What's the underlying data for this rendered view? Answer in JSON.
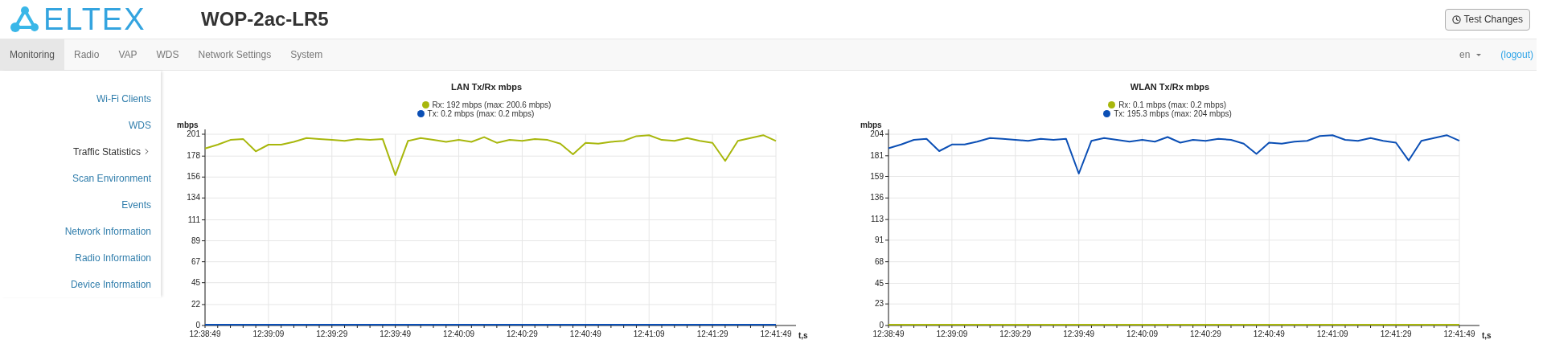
{
  "header": {
    "logo": "ELTEX",
    "title": "WOP-2ac-LR5",
    "button": "Test Changes"
  },
  "nav": {
    "tabs": [
      {
        "label": "Monitoring",
        "selected": true
      },
      {
        "label": "Radio",
        "selected": false
      },
      {
        "label": "VAP",
        "selected": false
      },
      {
        "label": "WDS",
        "selected": false
      },
      {
        "label": "Network Settings",
        "selected": false
      },
      {
        "label": "System",
        "selected": false
      }
    ],
    "language": "en",
    "logout": "(logout)"
  },
  "sidebar": {
    "items": [
      {
        "label": "Wi-Fi Clients",
        "selected": false
      },
      {
        "label": "WDS",
        "selected": false
      },
      {
        "label": "Traffic Statistics",
        "selected": true
      },
      {
        "label": "Scan Environment",
        "selected": false
      },
      {
        "label": "Events",
        "selected": false
      },
      {
        "label": "Network Information",
        "selected": false
      },
      {
        "label": "Radio Information",
        "selected": false
      },
      {
        "label": "Device Information",
        "selected": false
      }
    ]
  },
  "charts": [
    {
      "legend": [
        ": 192 mbps (max: 200.6 mbps)",
        ": 0.2 mbps (max: 0.2 mbps)"
      ],
      "chart_data": {
        "type": "line",
        "grid": true,
        "title": "LAN Tx/Rx mbps",
        "xlabel": "t,s",
        "ylabel": "mbps",
        "categories": [
          "12:38:49",
          null,
          null,
          null,
          null,
          "12:39:09",
          null,
          null,
          null,
          null,
          "12:39:29",
          null,
          null,
          null,
          null,
          "12:39:49",
          null,
          null,
          null,
          null,
          "12:40:09",
          null,
          null,
          null,
          null,
          "12:40:29",
          null,
          null,
          null,
          null,
          "12:40:49",
          null,
          null,
          null,
          null,
          "12:41:09",
          null,
          null,
          null,
          null,
          "12:41:29",
          null,
          null,
          null,
          null,
          "12:41:49"
        ],
        "ylim": [
          0,
          201
        ],
        "yticks": [
          0,
          22,
          45,
          67,
          89,
          111,
          134,
          156,
          178,
          201
        ],
        "series": [
          {
            "name": "Rx",
            "color": "#a8b70c",
            "values": [
              186,
              190,
              195,
              196,
              183,
              190,
              190,
              193,
              197,
              196,
              195,
              194,
              196,
              195,
              196,
              158,
              194,
              197,
              195,
              193,
              195,
              193,
              198,
              192,
              195,
              194,
              196,
              195,
              191,
              180,
              192,
              191,
              193,
              194,
              199,
              200,
              195,
              194,
              197,
              194,
              192,
              173,
              194,
              197,
              200,
              194
            ]
          },
          {
            "name": "Tx",
            "color": "#0b4fb5",
            "values": [
              0,
              0,
              0,
              0,
              0,
              0,
              0,
              0,
              0,
              0,
              0,
              0,
              0,
              0,
              0,
              0,
              0,
              0,
              0,
              0,
              0,
              0,
              0,
              0,
              0,
              0,
              0,
              0,
              0,
              0,
              0,
              0,
              0,
              0,
              0,
              0,
              0,
              0,
              0,
              0,
              0,
              0,
              0,
              0,
              0,
              0
            ]
          }
        ]
      }
    },
    {
      "legend": [
        ": 0.1 mbps (max: 0.2 mbps)",
        ": 195.3 mbps (max: 204 mbps)"
      ],
      "chart_data": {
        "type": "line",
        "grid": true,
        "title": "WLAN Tx/Rx mbps",
        "xlabel": "t,s",
        "ylabel": "mbps",
        "categories": [
          "12:38:49",
          null,
          null,
          null,
          null,
          "12:39:09",
          null,
          null,
          null,
          null,
          "12:39:29",
          null,
          null,
          null,
          null,
          "12:39:49",
          null,
          null,
          null,
          null,
          "12:40:09",
          null,
          null,
          null,
          null,
          "12:40:29",
          null,
          null,
          null,
          null,
          "12:40:49",
          null,
          null,
          null,
          null,
          "12:41:09",
          null,
          null,
          null,
          null,
          "12:41:29",
          null,
          null,
          null,
          null,
          "12:41:49"
        ],
        "ylim": [
          0,
          204
        ],
        "yticks": [
          0,
          23,
          45,
          68,
          91,
          113,
          136,
          159,
          181,
          204
        ],
        "series": [
          {
            "name": "Rx",
            "color": "#a8b70c",
            "values": [
              0,
              0,
              0,
              0,
              0,
              0,
              0,
              0,
              0,
              0,
              0,
              0,
              0,
              0,
              0,
              0,
              0,
              0,
              0,
              0,
              0,
              0,
              0,
              0,
              0,
              0,
              0,
              0,
              0,
              0,
              0,
              0,
              0,
              0,
              0,
              0,
              0,
              0,
              0,
              0,
              0,
              0,
              0,
              0,
              0,
              0
            ]
          },
          {
            "name": "Tx",
            "color": "#0b4fb5",
            "values": [
              189,
              193,
              198,
              199,
              186,
              193,
              193,
              196,
              200,
              199,
              198,
              197,
              199,
              198,
              199,
              162,
              197,
              200,
              198,
              196,
              198,
              196,
              201,
              195,
              198,
              197,
              199,
              198,
              194,
              183,
              195,
              194,
              196,
              197,
              202,
              203,
              198,
              197,
              200,
              197,
              195,
              176,
              197,
              200,
              203,
              197
            ]
          }
        ]
      }
    }
  ]
}
